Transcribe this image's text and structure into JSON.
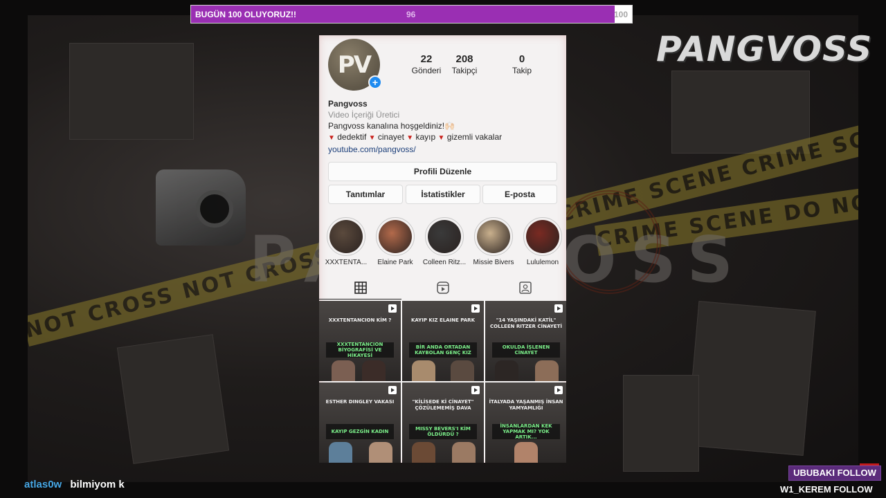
{
  "goal": {
    "label": "BUGÜN 100 OLUYORUZ!!",
    "current": "96",
    "target": "100",
    "progress": 0.96,
    "color": "#9a2fb3"
  },
  "overlay": {
    "channel_name": "PANGVOSS",
    "bg_title": "PANGVOSS",
    "tape_text_1": "NOT CROSS   NOT CROSS",
    "tape_text_2": "CRIME SCENE   CRIME SCENE",
    "tape_text_3": "CRIME SCENE   DO NOT CROSS"
  },
  "profile": {
    "avatar_text": "PV",
    "stats": [
      {
        "value": "22",
        "label": "Gönderi"
      },
      {
        "value": "208",
        "label": "Takipçi"
      },
      {
        "value": "0",
        "label": "Takip"
      }
    ],
    "name": "Pangvoss",
    "category": "Video İçeriği Üretici",
    "bio_line1": "Pangvoss kanalına hoşgeldiniz!🙌🏻",
    "bio_tags": [
      "dedektif",
      "cinayet",
      "kayıp",
      "gizemli vakalar"
    ],
    "link": "youtube.com/pangvoss/",
    "edit_button": "Profili Düzenle",
    "buttons": [
      "Tanıtımlar",
      "İstatistikler",
      "E-posta"
    ]
  },
  "highlights": [
    {
      "label": "XXXTENTA...",
      "color": "#5b4a3d"
    },
    {
      "label": "Elaine Park",
      "color": "#b36a4b"
    },
    {
      "label": "Colleen Ritz...",
      "color": "#3a3a3a"
    },
    {
      "label": "Missie Bivers",
      "color": "#c9b08d"
    },
    {
      "label": "Lululemon",
      "color": "#7a2a22"
    }
  ],
  "tabs": [
    {
      "icon": "grid-icon",
      "glyph": "▦"
    },
    {
      "icon": "reels-icon",
      "glyph": "▶"
    },
    {
      "icon": "tagged-icon",
      "glyph": "👤"
    }
  ],
  "posts": [
    {
      "title": "XXXTENTANCION KİM ?",
      "caption": "XXXTENTANCION BİYOGRAFİSİ VE HİKAYESİ"
    },
    {
      "title": "KAYIP KIZ ELAINE PARK",
      "caption": "BİR ANDA ORTADAN KAYBOLAN GENÇ KIZ"
    },
    {
      "title": "\"14 YAŞINDAKİ KATİL\" COLLEEN RITZER CİNAYETİ",
      "caption": "OKULDA İŞLENEN CİNAYET"
    },
    {
      "title": "ESTHER DINGLEY VAKASI",
      "caption": "KAYIP GEZGİN KADIN"
    },
    {
      "title": "\"KİLİSEDE Kİ CİNAYET\" ÇÖZÜLEMEMİŞ DAVA",
      "caption": "MISSY BEVERS'I KİM ÖLDÜRDÜ ?"
    },
    {
      "title": "İTALYADA YAŞANMIŞ İNSAN YAMYAMLIĞI",
      "caption": "İNSANLARDAN KEK YAPMAK MI? YOK ARTIK..."
    }
  ],
  "chat": {
    "user": "atlas0w",
    "message": "bilmiyom k"
  },
  "follows": {
    "first": "UBUBAKI  FOLLOW",
    "second": "W1_KEREM  FOLLOW"
  }
}
